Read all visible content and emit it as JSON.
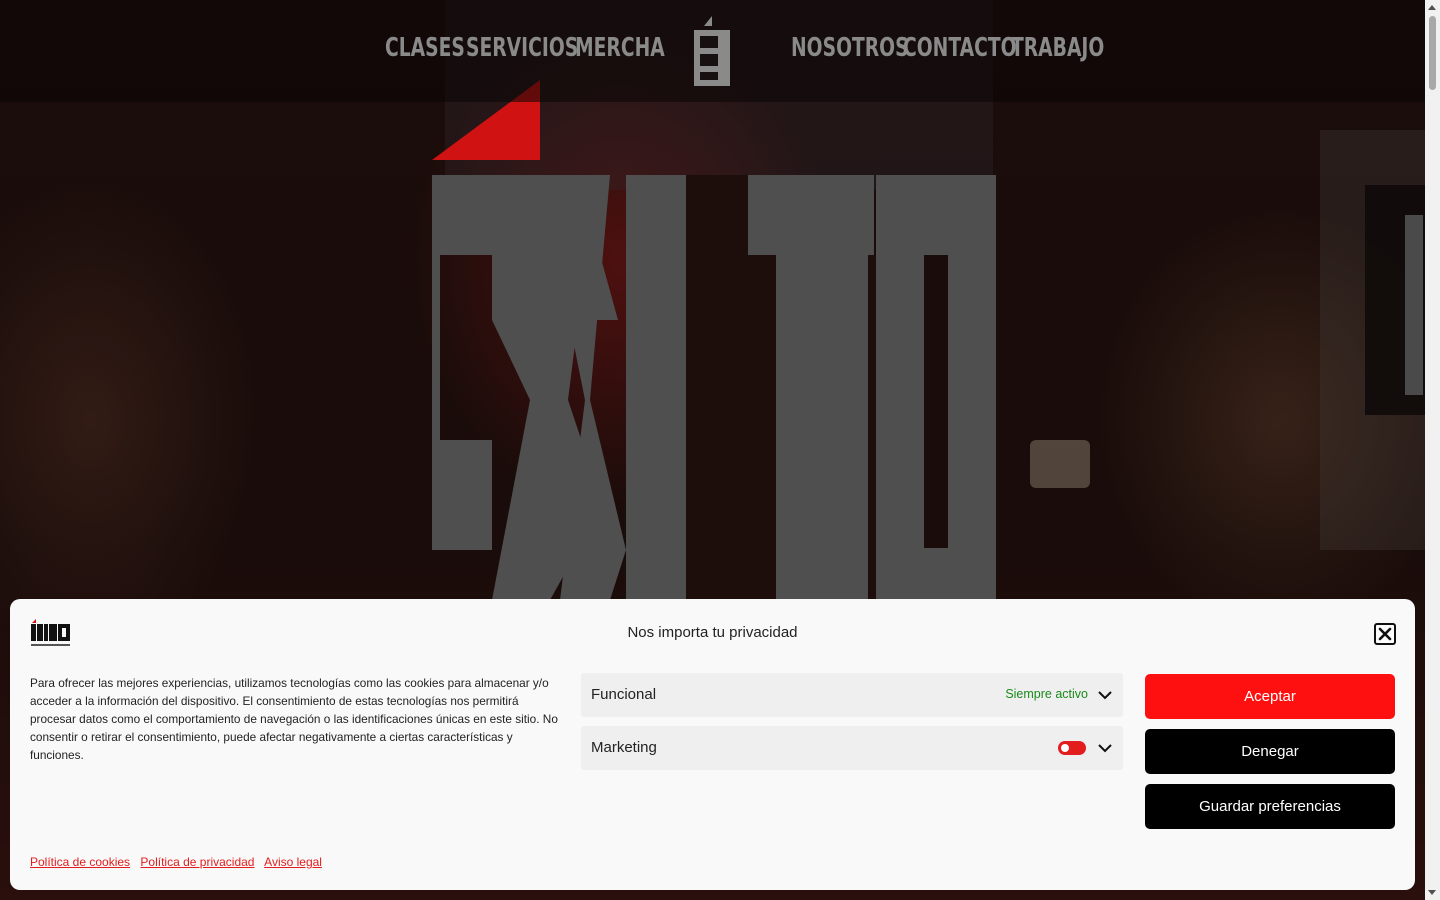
{
  "nav": {
    "left": [
      "CLASES",
      "SERVICIOS",
      "MERCHA"
    ],
    "right": [
      "NOSOTROS",
      "CONTACTO",
      "TRABAJO"
    ]
  },
  "hero": {
    "logo_text": "ÈXITO"
  },
  "banner": {
    "title": "Nos importa tu privacidad",
    "logo_text": "ÈXITO",
    "description": "Para ofrecer las mejores experiencias, utilizamos tecnologías como las cookies para almacenar y/o acceder a la información del dispositivo. El consentimiento de estas tecnologías nos permitirá procesar datos como el comportamiento de navegación o las identificaciones únicas en este sitio. No consentir o retirar el consentimiento, puede afectar negativamente a ciertas características y funciones.",
    "categories": [
      {
        "label": "Funcional",
        "status": "Siempre activo"
      },
      {
        "label": "Marketing",
        "toggle_on": false
      }
    ],
    "buttons": {
      "accept": "Aceptar",
      "deny": "Denegar",
      "save": "Guardar preferencias"
    },
    "links": [
      "Política de cookies",
      "Política de privacidad",
      "Aviso legal"
    ]
  },
  "colors": {
    "brand_red": "#ff1010",
    "logo_gray": "#4f4f4f",
    "always_active_green": "#1a8a1a"
  }
}
